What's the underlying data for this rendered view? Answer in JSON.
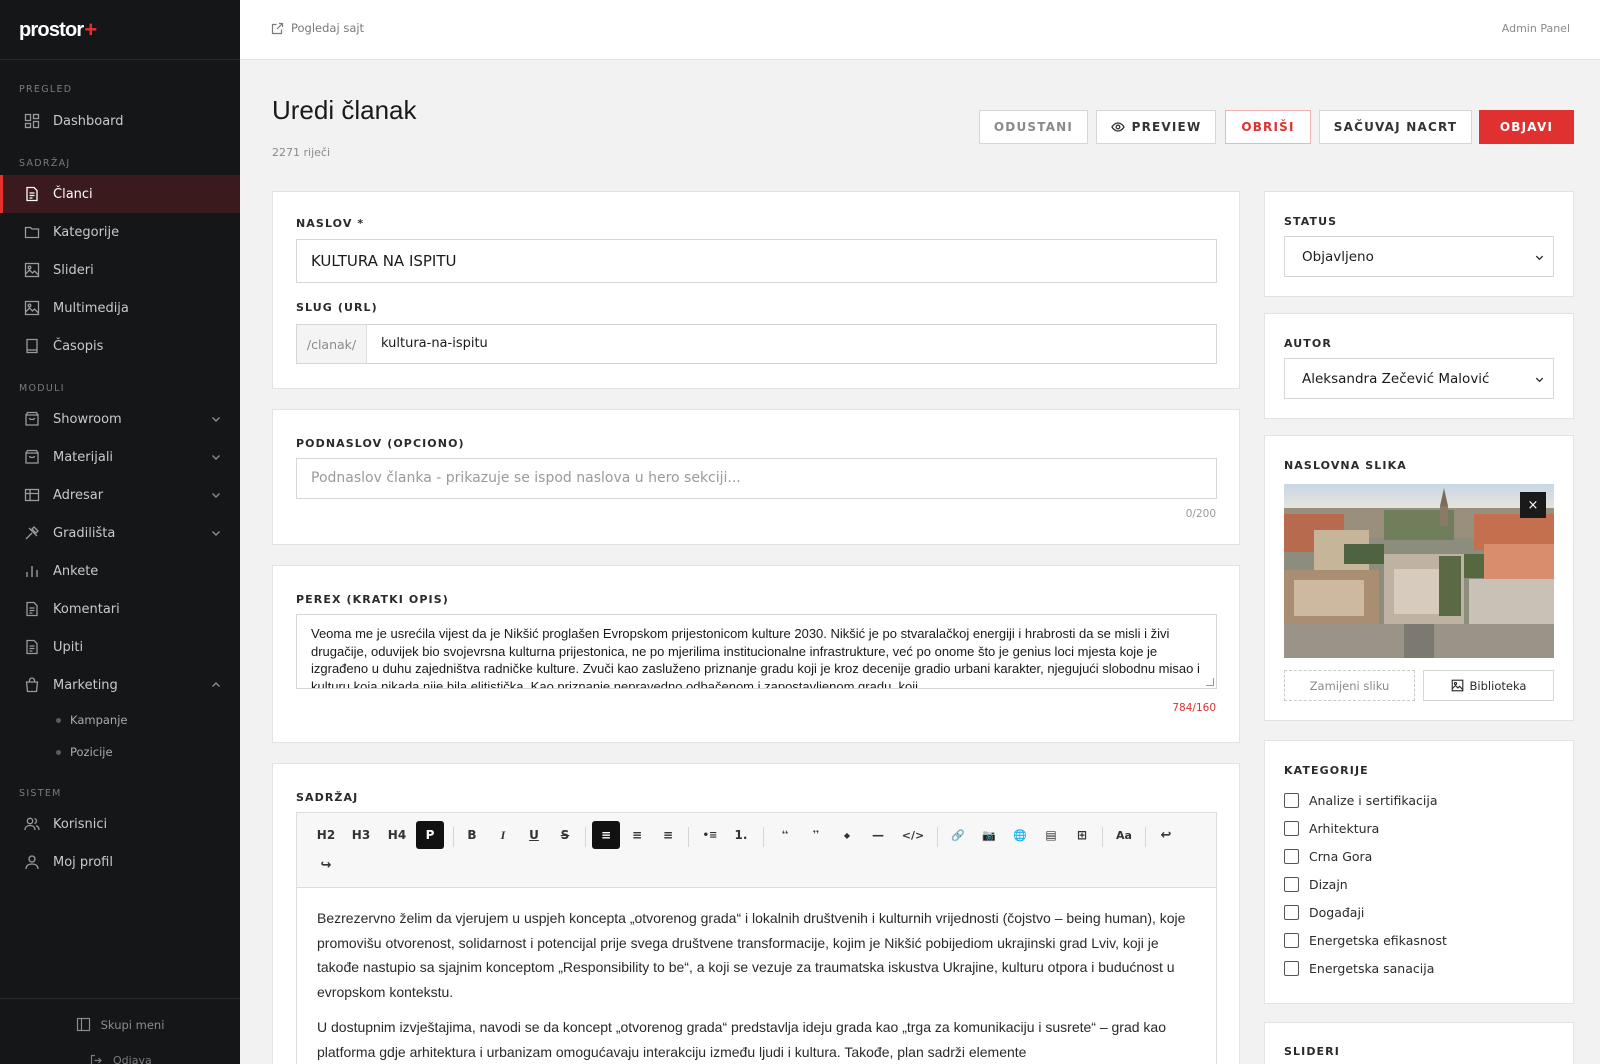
{
  "brand": {
    "name": "prostor",
    "mark": "+"
  },
  "sidebar": {
    "sections": {
      "pregled": "PREGLED",
      "sadrzaj": "SADRŽAJ",
      "moduli": "MODULI",
      "sistem": "SISTEM"
    },
    "items": {
      "dashboard": "Dashboard",
      "clanci": "Članci",
      "kategorije": "Kategorije",
      "slideri": "Slideri",
      "multimedija": "Multimedija",
      "casopis": "Časopis",
      "showroom": "Showroom",
      "materijali": "Materijali",
      "adresar": "Adresar",
      "gradilista": "Gradilišta",
      "ankete": "Ankete",
      "komentari": "Komentari",
      "upiti": "Upiti",
      "marketing": "Marketing",
      "kampanje": "Kampanje",
      "pozicije": "Pozicije",
      "korisnici": "Korisnici",
      "moj_profil": "Moj profil"
    },
    "collapse": "Skupi meni",
    "logout": "Odjava"
  },
  "topbar": {
    "view_site": "Pogledaj sajt",
    "admin_panel": "Admin Panel"
  },
  "header": {
    "title": "Uredi članak",
    "word_count": "2271 riječi",
    "buttons": {
      "cancel": "ODUSTANI",
      "preview": "PREVIEW",
      "delete": "OBRIŠI",
      "draft": "SAČUVAJ NACRT",
      "publish": "OBJAVI"
    }
  },
  "form": {
    "title_label": "NASLOV *",
    "title_value": "KULTURA NA ISPITU",
    "slug_label": "SLUG (URL)",
    "slug_prefix": "/clanak/",
    "slug_value": "kultura-na-ispitu",
    "subtitle_label": "PODNASLOV (OPCIONO)",
    "subtitle_placeholder": "Podnaslov članka - prikazuje se ispod naslova u hero sekciji...",
    "subtitle_counter": "0/200",
    "perex_label": "PEREX (KRATKI OPIS)",
    "perex_value": "Veoma me je usrećila vijest da je Nikšić proglašen Evropskom prijestonicom kulture 2030. Nikšić je po stvaralačkoj energiji i hrabrosti da se misli i živi drugačije, oduvijek bio svojevrsna kulturna prijestonica, ne po mjerilima institucionalne infrastrukture, već po onome što je genius loci mjesta koje je izgrađeno u duhu zajedništva radničke kulture. Zvuči kao zasluženo priznanje gradu koji je kroz decenije gradio urbani karakter, njegujući slobodnu misao i kulturu koja nikada nije bila elitistička. Kao priznanje nepravedno odbačenom i zapostavljenom gradu, koji",
    "perex_counter": "784/160",
    "content_label": "SADRŽAJ",
    "toolbar": {
      "h2": "H2",
      "h3": "H3",
      "h4": "H4",
      "p": "P",
      "bold": "B",
      "italic": "I",
      "underline": "U",
      "strike": "S",
      "align_left": "≡",
      "align_center": "≡",
      "align_right": "≡",
      "bullet_list": "•≡",
      "ordered_list": "1.",
      "quote_open": "❛❛",
      "quote_close": "❜❜",
      "diamond": "◆",
      "hr": "—",
      "code": "</>",
      "link": "🔗",
      "image": "📷",
      "embed": "🌐",
      "gallery": "▤",
      "table": "⊞",
      "font": "Aa",
      "undo": "↩",
      "redo": "↪"
    },
    "content_paragraphs": [
      "Bezrezervno želim da vjerujem u uspjeh koncepta „otvorenog grada“ i lokalnih društvenih i kulturnih vrijednosti (čojstvo – being human), koje promovišu otvorenost, solidarnost i potencijal prije svega društvene transformacije, kojim je Nikšić pobijediom ukrajinski grad Lviv, koji je takođe nastupio sa sjajnim konceptom „Responsibility to be“, a koji se vezuje za traumatska iskustva Ukrajine, kulturu otpora i budućnost u evropskom kontekstu.",
      "U dostupnim izvještajima, navodi se da koncept „otvorenog grada“ predstavlja ideju grada kao „trga za komunikaciju i susrete“ – grad kao platforma gdje arhitektura i urbanizam omogućavaju interakciju između ljudi i kultura. Takođe, plan sadrži elemente"
    ]
  },
  "right": {
    "status_label": "STATUS",
    "status_value": "Objavljeno",
    "author_label": "AUTOR",
    "author_value": "Aleksandra Zečević Malović",
    "cover_label": "NASLOVNA SLIKA",
    "replace": "Zamijeni sliku",
    "library": "Biblioteka",
    "close": "×",
    "categories_label": "KATEGORIJE",
    "categories": [
      "Analize i sertifikacija",
      "Arhitektura",
      "Crna Gora",
      "Dizajn",
      "Događaji",
      "Energetska efikasnost",
      "Energetska sanacija"
    ],
    "sliders_label": "SLIDERI"
  },
  "colors": {
    "accent": "#e03131",
    "sidebar_bg": "#151618",
    "active_bg": "#3a1a1c"
  }
}
